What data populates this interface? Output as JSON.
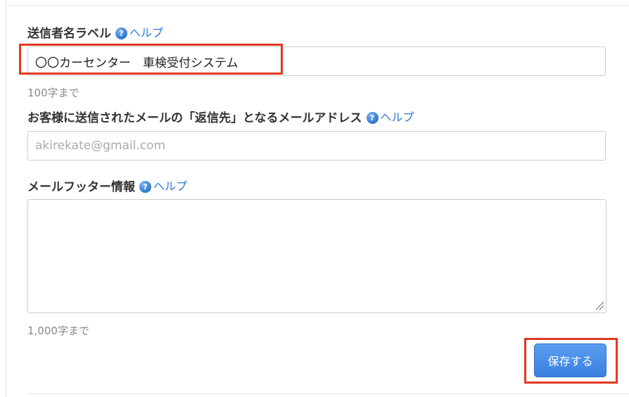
{
  "sender_label": {
    "label": "送信者名ラベル",
    "help_icon": "question-circle-icon",
    "help_text": "ヘルプ",
    "value": "〇〇カーセンター　車検受付システム",
    "hint": "100字まで"
  },
  "reply_to": {
    "label": "お客様に送信されたメールの「返信先」となるメールアドレス",
    "help_icon": "question-circle-icon",
    "help_text": "ヘルプ",
    "value": "",
    "placeholder": "akirekate@gmail.com"
  },
  "footer": {
    "label": "メールフッター情報",
    "help_icon": "question-circle-icon",
    "help_text": "ヘルプ",
    "value": "",
    "hint": "1,000字まで"
  },
  "actions": {
    "save_label": "保存する"
  },
  "colors": {
    "highlight": "#e03a22",
    "link": "#2e7ad6",
    "button": "#4a8ee6"
  }
}
